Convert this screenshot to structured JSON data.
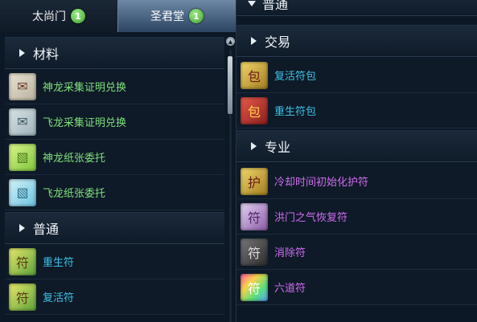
{
  "left_panel": {
    "tabs": [
      {
        "label": "太尚门",
        "badge": "1",
        "active": false
      },
      {
        "label": "圣君堂",
        "badge": "1",
        "active": true
      }
    ],
    "sections": [
      {
        "title": "材料",
        "items": [
          {
            "label": "神龙采集证明兑换",
            "icon": "paper-scroll-icon"
          },
          {
            "label": "飞龙采集证明兑换",
            "icon": "paper-scroll-icon"
          },
          {
            "label": "神龙纸张委托",
            "icon": "green-paper-icon"
          },
          {
            "label": "飞龙纸张委托",
            "icon": "cyan-paper-icon"
          }
        ]
      },
      {
        "title": "普通",
        "items": [
          {
            "label": "重生符",
            "icon": "talisman-icon"
          },
          {
            "label": "复活符",
            "icon": "talisman-icon"
          }
        ]
      }
    ]
  },
  "right_panel": {
    "sections": [
      {
        "title": "普通",
        "items": []
      },
      {
        "title": "交易",
        "items": [
          {
            "label": "复活符包",
            "icon": "talisman-pack-icon"
          },
          {
            "label": "重生符包",
            "icon": "talisman-pack-icon"
          }
        ]
      },
      {
        "title": "专业",
        "items": [
          {
            "label": "冷却时间初始化护符",
            "icon": "amulet-icon"
          },
          {
            "label": "洪门之气恢复符",
            "icon": "talisman-icon"
          },
          {
            "label": "消除符",
            "icon": "talisman-icon"
          },
          {
            "label": "六道符",
            "icon": "talisman-icon"
          }
        ]
      }
    ]
  },
  "colors": {
    "material_text": "#7ee07a",
    "common_text": "#3fc2e6",
    "special_text": "#d06cf0",
    "badge": "#4caf3a"
  }
}
